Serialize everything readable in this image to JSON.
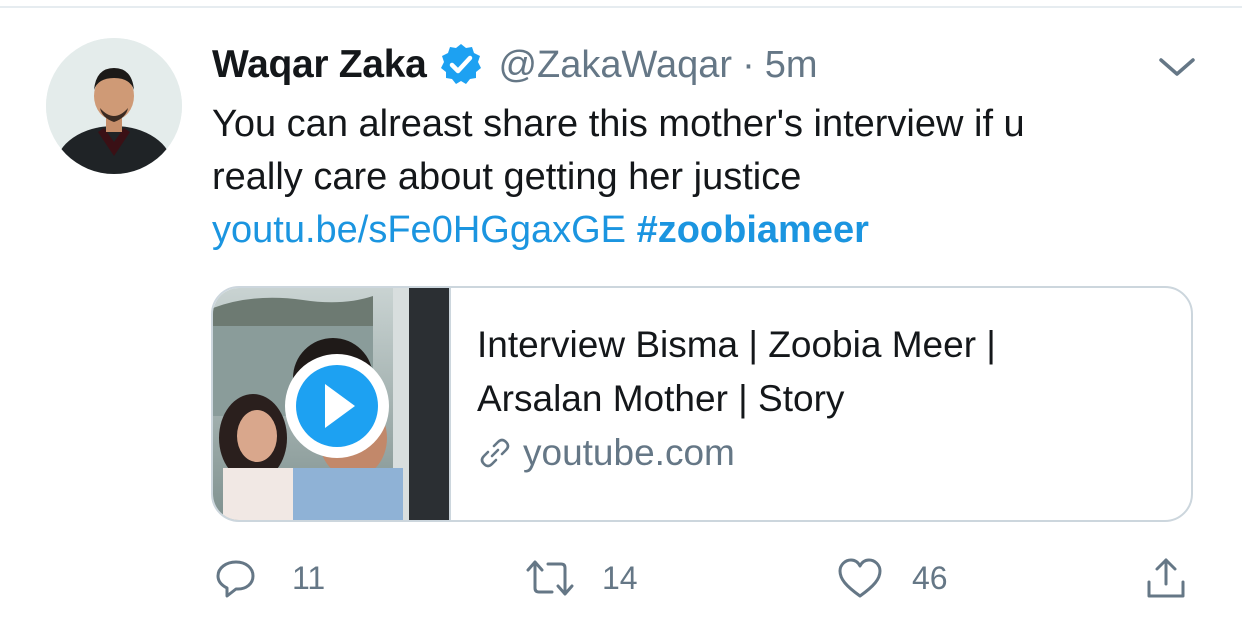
{
  "tweet": {
    "author_name": "Waqar Zaka",
    "handle": "@ZakaWaqar",
    "separator": "·",
    "time": "5m",
    "text_line1": "You can alreast share this mother's interview if u",
    "text_line2": "really care about getting her justice",
    "link_text": "youtu.be/sFe0HGgaxGE",
    "hashtag": "#zoobiameer",
    "verified": true
  },
  "card": {
    "title_line1": "Interview Bisma | Zoobia Meer |",
    "title_line2": "Arsalan Mother | Story",
    "domain": "youtube.com",
    "thumbnail_icon": "play-icon"
  },
  "actions": {
    "reply_count": "11",
    "retweet_count": "14",
    "like_count": "46"
  },
  "colors": {
    "accent": "#1da1f2",
    "link": "#1b95e0",
    "text": "#14171a",
    "secondary": "#657786",
    "border": "#ccd6dd"
  }
}
